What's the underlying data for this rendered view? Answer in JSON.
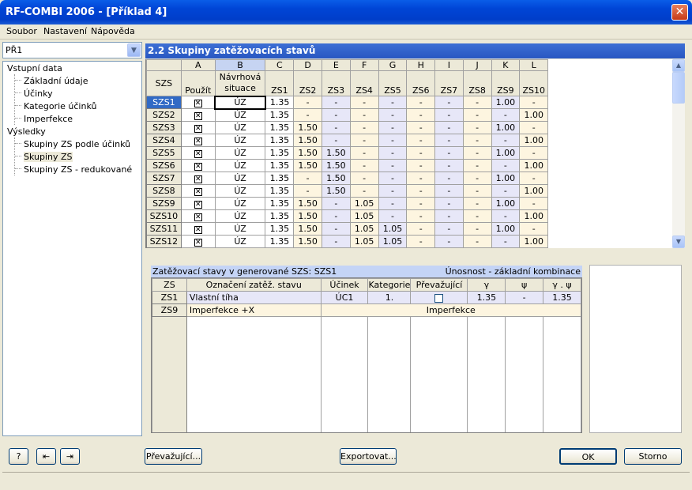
{
  "window": {
    "title": "RF-COMBI 2006 - [Příklad 4]"
  },
  "menu": [
    "Soubor",
    "Nastavení",
    "Nápověda"
  ],
  "combo": {
    "value": "PŘ1"
  },
  "tree": {
    "group1": "Vstupní data",
    "group1_items": [
      "Základní údaje",
      "Účinky",
      "Kategorie účinků",
      "Imperfekce"
    ],
    "group2": "Výsledky",
    "group2_items": [
      "Skupiny ZS podle účinků",
      "Skupiny ZS",
      "Skupiny ZS - redukované"
    ]
  },
  "main": {
    "title": "2.2 Skupiny zatěžovacích stavů"
  },
  "grid1": {
    "col_letters": [
      "A",
      "B",
      "C",
      "D",
      "E",
      "F",
      "G",
      "H",
      "I",
      "J",
      "K",
      "L"
    ],
    "row_header": "SZS",
    "col_a": "Použít",
    "col_b": "Návrhová situace",
    "zs_headers": [
      "ZS1",
      "ZS2",
      "ZS3",
      "ZS4",
      "ZS5",
      "ZS6",
      "ZS7",
      "ZS8",
      "ZS9",
      "ZS10"
    ],
    "rows": [
      {
        "id": "SZS1",
        "sit": "ÚZ",
        "v": [
          "1.35",
          "-",
          "-",
          "-",
          "-",
          "-",
          "-",
          "-",
          "1.00",
          "-"
        ]
      },
      {
        "id": "SZS2",
        "sit": "ÚZ",
        "v": [
          "1.35",
          "-",
          "-",
          "-",
          "-",
          "-",
          "-",
          "-",
          "-",
          "1.00"
        ]
      },
      {
        "id": "SZS3",
        "sit": "ÚZ",
        "v": [
          "1.35",
          "1.50",
          "-",
          "-",
          "-",
          "-",
          "-",
          "-",
          "1.00",
          "-"
        ]
      },
      {
        "id": "SZS4",
        "sit": "ÚZ",
        "v": [
          "1.35",
          "1.50",
          "-",
          "-",
          "-",
          "-",
          "-",
          "-",
          "-",
          "1.00"
        ]
      },
      {
        "id": "SZS5",
        "sit": "ÚZ",
        "v": [
          "1.35",
          "1.50",
          "1.50",
          "-",
          "-",
          "-",
          "-",
          "-",
          "1.00",
          "-"
        ]
      },
      {
        "id": "SZS6",
        "sit": "ÚZ",
        "v": [
          "1.35",
          "1.50",
          "1.50",
          "-",
          "-",
          "-",
          "-",
          "-",
          "-",
          "1.00"
        ]
      },
      {
        "id": "SZS7",
        "sit": "ÚZ",
        "v": [
          "1.35",
          "-",
          "1.50",
          "-",
          "-",
          "-",
          "-",
          "-",
          "1.00",
          "-"
        ]
      },
      {
        "id": "SZS8",
        "sit": "ÚZ",
        "v": [
          "1.35",
          "-",
          "1.50",
          "-",
          "-",
          "-",
          "-",
          "-",
          "-",
          "1.00"
        ]
      },
      {
        "id": "SZS9",
        "sit": "ÚZ",
        "v": [
          "1.35",
          "1.50",
          "-",
          "1.05",
          "-",
          "-",
          "-",
          "-",
          "1.00",
          "-"
        ]
      },
      {
        "id": "SZS10",
        "sit": "ÚZ",
        "v": [
          "1.35",
          "1.50",
          "-",
          "1.05",
          "-",
          "-",
          "-",
          "-",
          "-",
          "1.00"
        ]
      },
      {
        "id": "SZS11",
        "sit": "ÚZ",
        "v": [
          "1.35",
          "1.50",
          "-",
          "1.05",
          "1.05",
          "-",
          "-",
          "-",
          "1.00",
          "-"
        ]
      },
      {
        "id": "SZS12",
        "sit": "ÚZ",
        "v": [
          "1.35",
          "1.50",
          "-",
          "1.05",
          "1.05",
          "-",
          "-",
          "-",
          "-",
          "1.00"
        ]
      }
    ]
  },
  "lower": {
    "title": "Zatěžovací stavy v generované SZS: SZS1",
    "right_title": "Únosnost - základní kombinace",
    "headers": [
      "ZS",
      "Označení zatěž. stavu",
      "Účinek",
      "Kategorie",
      "Převažující",
      "γ",
      "ψ",
      "γ . ψ"
    ],
    "row1": {
      "zs": "ZS1",
      "name": "Vlastní tíha",
      "ucinek": "ÚC1",
      "kat": "1.",
      "gamma": "1.35",
      "psi": "-",
      "gp": "1.35"
    },
    "row2": {
      "zs": "ZS9",
      "name": "Imperfekce +X",
      "span": "Imperfekce"
    }
  },
  "buttons": {
    "prevazujici": "Převažující...",
    "export": "Exportovat...",
    "ok": "OK",
    "storno": "Storno"
  }
}
